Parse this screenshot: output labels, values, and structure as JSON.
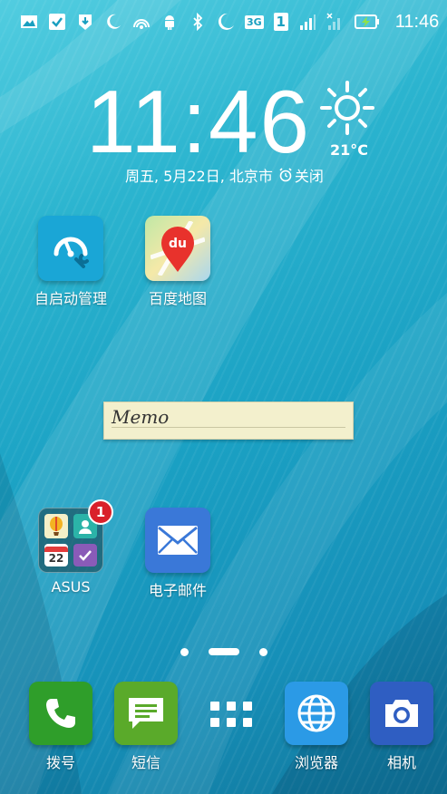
{
  "status_bar": {
    "time": "11:46",
    "network_badge": "3G",
    "sim_badge": "1",
    "icons": [
      "gallery-icon",
      "check-icon",
      "download-icon",
      "moon-icon",
      "wifi-hotspot-icon",
      "android-icon",
      "bluetooth-icon",
      "do-not-disturb-icon",
      "signal-icon",
      "no-signal-icon",
      "battery-charging-icon"
    ]
  },
  "clock": {
    "hours": "11",
    "separator": ":",
    "minutes": "46",
    "temperature": "21°C",
    "weather_icon": "sun-icon",
    "date": "周五, 5月22日, 北京市",
    "alarm_label": "关闭"
  },
  "apps": {
    "autostart": {
      "label": "自启动管理",
      "icon": "speedometer-wrench-icon",
      "color": "#1aa6d6"
    },
    "baidu_map": {
      "label": "百度地图",
      "icon": "map-pin-icon",
      "icon_text": "du",
      "color": "#e8322c"
    },
    "asus_folder": {
      "label": "ASUS",
      "badge": "1",
      "mini_date": "22"
    },
    "email": {
      "label": "电子邮件",
      "icon": "envelope-icon",
      "color": "#3a78d8"
    }
  },
  "memo": {
    "text": "Memo"
  },
  "pager": {
    "pages": 3,
    "current": 2
  },
  "dock": {
    "dialer": {
      "label": "拨号",
      "icon": "phone-icon",
      "color": "#2f9e2a"
    },
    "messages": {
      "label": "短信",
      "icon": "message-icon",
      "color": "#5aaa2a"
    },
    "browser": {
      "label": "浏览器",
      "icon": "globe-icon",
      "color": "#2b9ae6"
    },
    "camera": {
      "label": "相机",
      "icon": "camera-icon",
      "color": "#2f5ec2"
    }
  }
}
